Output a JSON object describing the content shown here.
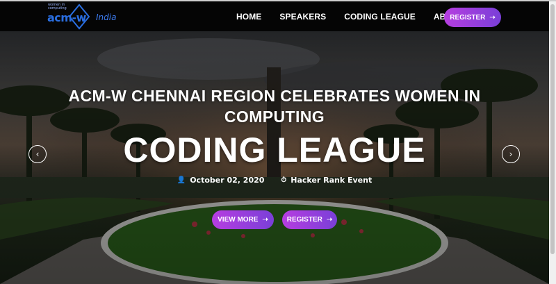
{
  "logo": {
    "tagline": "women in computing",
    "name": "acm-w",
    "region": "India"
  },
  "nav": {
    "items": [
      "HOME",
      "SPEAKERS",
      "CODING LEAGUE",
      "ABOUT"
    ],
    "register_label": "REGISTER",
    "register_icon": "arrow-right-icon"
  },
  "hero": {
    "subtitle_line1": "ACM-W CHENNAI REGION CELEBRATES WOMEN IN",
    "subtitle_line2": "COMPUTING",
    "title": "CODING LEAGUE",
    "date": "October 02, 2020",
    "date_icon": "person-icon",
    "venue": "Hacker Rank Event",
    "venue_icon": "clock-shield-icon",
    "view_more_label": "VIEW MORE",
    "register_label": "REGISTER",
    "prev_icon": "chevron-left-icon",
    "next_icon": "chevron-right-icon"
  },
  "colors": {
    "accent_start": "#b63ee0",
    "accent_end": "#7a3fd8",
    "nav_bg": "#050505",
    "logo_blue": "#2a6ee0"
  }
}
